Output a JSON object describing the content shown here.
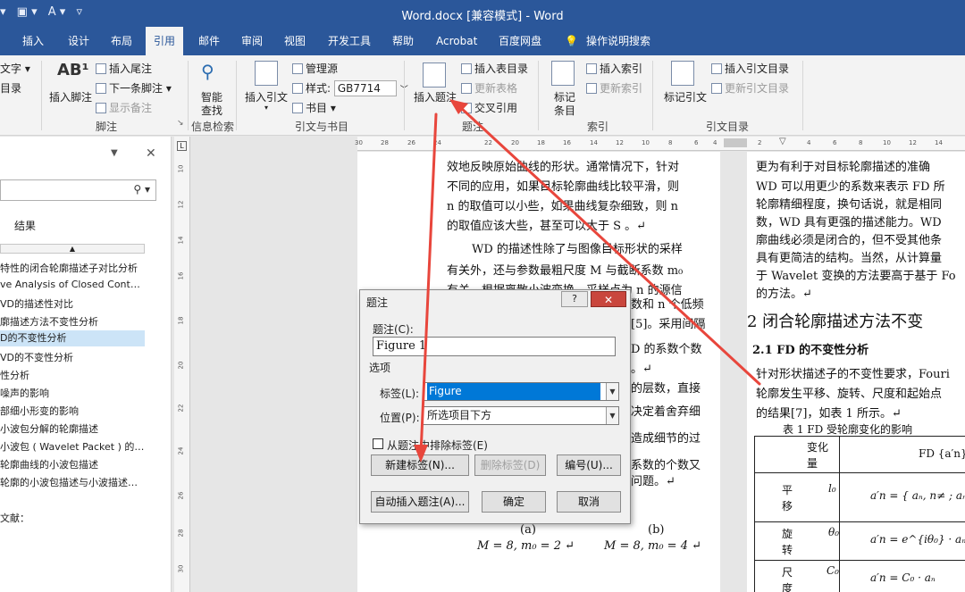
{
  "titlebar": {
    "title": "Word.docx [兼容模式] - Word",
    "qat": [
      "▾",
      "▣ ▾",
      "A ▾",
      "▿"
    ]
  },
  "tabs": [
    "插入",
    "设计",
    "布局",
    "引用",
    "邮件",
    "审阅",
    "视图",
    "开发工具",
    "帮助",
    "Acrobat",
    "百度网盘",
    "操作说明搜索"
  ],
  "ribbon": {
    "toc": [
      "文字 ▾",
      "目录"
    ],
    "footnote": {
      "insert_footnote": "插入脚注",
      "insert_endnote": "插入尾注",
      "next_footnote": "下一条脚注 ▾",
      "show_notes": "显示备注",
      "group": "脚注"
    },
    "research": {
      "smart_lookup": "智能",
      "smart_lookup2": "查找",
      "group": "信息检索"
    },
    "citations": {
      "insert_citation": "插入引文",
      "manage_sources": "管理源",
      "style_label": "样式:",
      "style_value": "GB7714",
      "bibliography": "书目 ▾",
      "group": "引文与书目"
    },
    "captions": {
      "insert_caption": "插入题注",
      "insert_table_of_figures": "插入表目录",
      "update_table": "更新表格",
      "cross_reference": "交叉引用",
      "group": "题注"
    },
    "index": {
      "mark_entry": "标记",
      "mark_entry2": "条目",
      "insert_index": "插入索引",
      "update_index": "更新索引",
      "group": "索引"
    },
    "toa": {
      "mark_citation": "标记引文",
      "insert_toa": "插入引文目录",
      "update_toa": "更新引文目录",
      "group": "引文目录"
    }
  },
  "nav": {
    "close": "✕",
    "dropdown": "▼",
    "results_label": "结果",
    "items": [
      "特性的闭合轮廓描述子对比分析",
      "ve Analysis of Closed Cont…",
      "VD的描述性对比",
      "廓描述方法不变性分析",
      "D的不变性分析",
      "VD的不变性分析",
      "性分析",
      "噪声的影响",
      "部细小形变的影响",
      "小波包分解的轮廓描述",
      "小波包 ( Wavelet Packet ) 的…",
      "轮廓曲线的小波包描述",
      "轮廓的小波包描述与小波描述…",
      "文献："
    ]
  },
  "ruler": {
    "h_ticks": [
      "30",
      "28",
      "26",
      "24",
      "22",
      "20",
      "18",
      "16",
      "14",
      "12",
      "10",
      "8",
      "6",
      "4",
      "2",
      "4",
      "6",
      "8",
      "10",
      "12",
      "14"
    ],
    "v_ticks": [
      "10",
      "12",
      "14",
      "16",
      "18",
      "20",
      "22",
      "24",
      "26",
      "28",
      "30"
    ]
  },
  "page_left": {
    "lines": [
      "效地反映原始曲线的形状。通常情况下，针对",
      "不同的应用，如果目标轮廓曲线比较平滑，则",
      "n 的取值可以小些，如果曲线复杂细致，则 n",
      "的取值应该大些，甚至可以大于 S 。↵",
      "WD 的描述性除了与图像目标形状的采样",
      "有关外，还与参数最粗尺度 M 与截断系数 m₀",
      "有关。根据离散小波变换，采样点为 n 的源信",
      "数和 n 个低频",
      "[5]。采用间隔",
      "D 的系数个数",
      "。↵",
      "的层数，直接",
      "决定着舍弃细",
      "造成细节的过",
      "系数的个数又",
      "问题。↵"
    ],
    "sub_a": "(a)",
    "sub_b": "(b)",
    "formula_a": "M = 8, m₀ = 2 ↵",
    "formula_b": "M = 8, m₀ = 4 ↵"
  },
  "page_right": {
    "lines": [
      "更为有利于对目标轮廓描述的准确",
      "WD 可以用更少的系数来表示 FD 所",
      "轮廓精细程度，换句话说，就是相同",
      "数，WD 具有更强的描述能力。WD",
      "廓曲线必须是闭合的，但不受其他条",
      "具有更简洁的结构。当然，从计算量",
      "于 Wavelet 变换的方法要高于基于 Fo",
      "的方法。↵"
    ],
    "heading": "2   闭合轮廓描述方法不变",
    "subheading": "2.1      FD 的不变性分析",
    "body": [
      "针对形状描述子的不变性要求，Fouri",
      "轮廓发生平移、旋转、尺度和起始点",
      "的结果[7]，如表 1 所示。↵"
    ],
    "table_caption": "表 1   FD 受轮廓变化的影响",
    "table": {
      "header": [
        "变化量",
        "FD {a′n}"
      ],
      "rows": [
        [
          "平移",
          "l₀",
          "a′n = { aₙ, n≠ ; aₙ+l₀, n="
        ],
        [
          "旋转",
          "θ₀",
          "a′n = e^{iθ₀} · aₙ"
        ],
        [
          "尺度",
          "C₀",
          "a′n = C₀ · aₙ"
        ]
      ]
    }
  },
  "dialog": {
    "title": "题注",
    "help": "?",
    "close": "✕",
    "caption_label": "题注(C):",
    "caption_value": "Figure 1",
    "options_label": "选项",
    "label_label": "标签(L):",
    "label_value": "Figure",
    "position_label": "位置(P):",
    "position_value": "所选项目下方",
    "exclude_label": "从题注中排除标签(E)",
    "new_label": "新建标签(N)...",
    "delete_label": "删除标签(D)",
    "numbering": "编号(U)...",
    "autocaption": "自动插入题注(A)...",
    "ok": "确定",
    "cancel": "取消"
  },
  "colors": {
    "accent": "#2b579a",
    "arrow": "#e8463c",
    "selection": "#0078d7"
  }
}
